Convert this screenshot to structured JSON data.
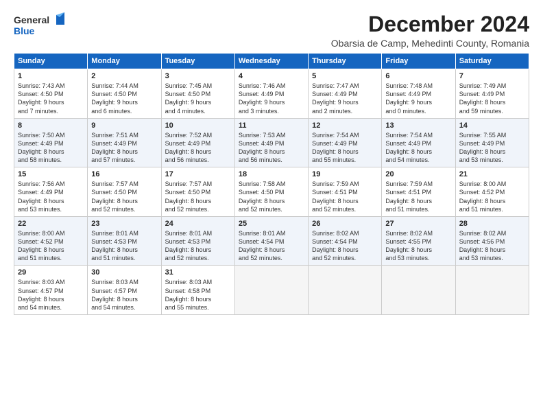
{
  "logo": {
    "line1": "General",
    "line2": "Blue"
  },
  "title": "December 2024",
  "subtitle": "Obarsia de Camp, Mehedinti County, Romania",
  "days_header": [
    "Sunday",
    "Monday",
    "Tuesday",
    "Wednesday",
    "Thursday",
    "Friday",
    "Saturday"
  ],
  "weeks": [
    [
      {
        "day": "1",
        "text": "Sunrise: 7:43 AM\nSunset: 4:50 PM\nDaylight: 9 hours\nand 7 minutes."
      },
      {
        "day": "2",
        "text": "Sunrise: 7:44 AM\nSunset: 4:50 PM\nDaylight: 9 hours\nand 6 minutes."
      },
      {
        "day": "3",
        "text": "Sunrise: 7:45 AM\nSunset: 4:50 PM\nDaylight: 9 hours\nand 4 minutes."
      },
      {
        "day": "4",
        "text": "Sunrise: 7:46 AM\nSunset: 4:49 PM\nDaylight: 9 hours\nand 3 minutes."
      },
      {
        "day": "5",
        "text": "Sunrise: 7:47 AM\nSunset: 4:49 PM\nDaylight: 9 hours\nand 2 minutes."
      },
      {
        "day": "6",
        "text": "Sunrise: 7:48 AM\nSunset: 4:49 PM\nDaylight: 9 hours\nand 0 minutes."
      },
      {
        "day": "7",
        "text": "Sunrise: 7:49 AM\nSunset: 4:49 PM\nDaylight: 8 hours\nand 59 minutes."
      }
    ],
    [
      {
        "day": "8",
        "text": "Sunrise: 7:50 AM\nSunset: 4:49 PM\nDaylight: 8 hours\nand 58 minutes."
      },
      {
        "day": "9",
        "text": "Sunrise: 7:51 AM\nSunset: 4:49 PM\nDaylight: 8 hours\nand 57 minutes."
      },
      {
        "day": "10",
        "text": "Sunrise: 7:52 AM\nSunset: 4:49 PM\nDaylight: 8 hours\nand 56 minutes."
      },
      {
        "day": "11",
        "text": "Sunrise: 7:53 AM\nSunset: 4:49 PM\nDaylight: 8 hours\nand 56 minutes."
      },
      {
        "day": "12",
        "text": "Sunrise: 7:54 AM\nSunset: 4:49 PM\nDaylight: 8 hours\nand 55 minutes."
      },
      {
        "day": "13",
        "text": "Sunrise: 7:54 AM\nSunset: 4:49 PM\nDaylight: 8 hours\nand 54 minutes."
      },
      {
        "day": "14",
        "text": "Sunrise: 7:55 AM\nSunset: 4:49 PM\nDaylight: 8 hours\nand 53 minutes."
      }
    ],
    [
      {
        "day": "15",
        "text": "Sunrise: 7:56 AM\nSunset: 4:49 PM\nDaylight: 8 hours\nand 53 minutes."
      },
      {
        "day": "16",
        "text": "Sunrise: 7:57 AM\nSunset: 4:50 PM\nDaylight: 8 hours\nand 52 minutes."
      },
      {
        "day": "17",
        "text": "Sunrise: 7:57 AM\nSunset: 4:50 PM\nDaylight: 8 hours\nand 52 minutes."
      },
      {
        "day": "18",
        "text": "Sunrise: 7:58 AM\nSunset: 4:50 PM\nDaylight: 8 hours\nand 52 minutes."
      },
      {
        "day": "19",
        "text": "Sunrise: 7:59 AM\nSunset: 4:51 PM\nDaylight: 8 hours\nand 52 minutes."
      },
      {
        "day": "20",
        "text": "Sunrise: 7:59 AM\nSunset: 4:51 PM\nDaylight: 8 hours\nand 51 minutes."
      },
      {
        "day": "21",
        "text": "Sunrise: 8:00 AM\nSunset: 4:52 PM\nDaylight: 8 hours\nand 51 minutes."
      }
    ],
    [
      {
        "day": "22",
        "text": "Sunrise: 8:00 AM\nSunset: 4:52 PM\nDaylight: 8 hours\nand 51 minutes."
      },
      {
        "day": "23",
        "text": "Sunrise: 8:01 AM\nSunset: 4:53 PM\nDaylight: 8 hours\nand 51 minutes."
      },
      {
        "day": "24",
        "text": "Sunrise: 8:01 AM\nSunset: 4:53 PM\nDaylight: 8 hours\nand 52 minutes."
      },
      {
        "day": "25",
        "text": "Sunrise: 8:01 AM\nSunset: 4:54 PM\nDaylight: 8 hours\nand 52 minutes."
      },
      {
        "day": "26",
        "text": "Sunrise: 8:02 AM\nSunset: 4:54 PM\nDaylight: 8 hours\nand 52 minutes."
      },
      {
        "day": "27",
        "text": "Sunrise: 8:02 AM\nSunset: 4:55 PM\nDaylight: 8 hours\nand 53 minutes."
      },
      {
        "day": "28",
        "text": "Sunrise: 8:02 AM\nSunset: 4:56 PM\nDaylight: 8 hours\nand 53 minutes."
      }
    ],
    [
      {
        "day": "29",
        "text": "Sunrise: 8:03 AM\nSunset: 4:57 PM\nDaylight: 8 hours\nand 54 minutes."
      },
      {
        "day": "30",
        "text": "Sunrise: 8:03 AM\nSunset: 4:57 PM\nDaylight: 8 hours\nand 54 minutes."
      },
      {
        "day": "31",
        "text": "Sunrise: 8:03 AM\nSunset: 4:58 PM\nDaylight: 8 hours\nand 55 minutes."
      },
      {
        "day": "",
        "text": ""
      },
      {
        "day": "",
        "text": ""
      },
      {
        "day": "",
        "text": ""
      },
      {
        "day": "",
        "text": ""
      }
    ]
  ],
  "row_backgrounds": [
    "#ffffff",
    "#f0f4fa",
    "#ffffff",
    "#f0f4fa",
    "#f0f4fa"
  ]
}
